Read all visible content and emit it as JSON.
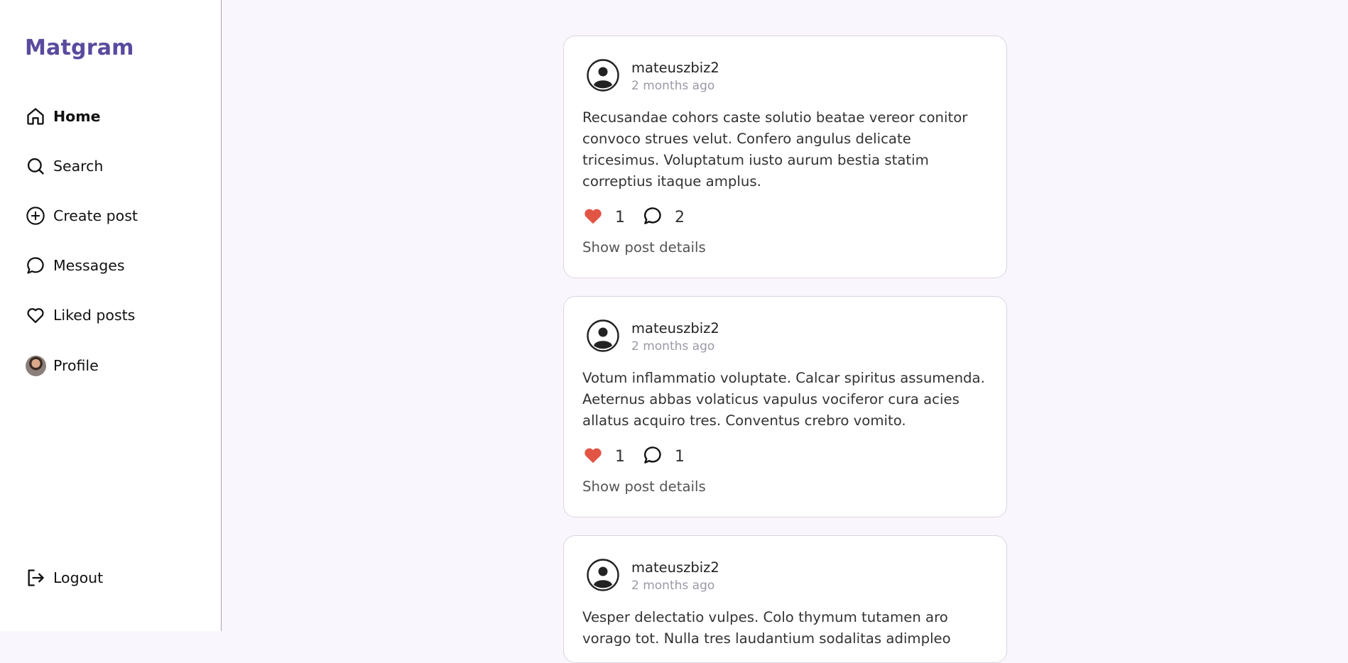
{
  "app": {
    "brand": "Matgram"
  },
  "sidebar": {
    "items": [
      {
        "label": "Home",
        "icon": "home-icon"
      },
      {
        "label": "Search",
        "icon": "search-icon"
      },
      {
        "label": "Create post",
        "icon": "plus-circle-icon"
      },
      {
        "label": "Messages",
        "icon": "chat-bubble-icon"
      },
      {
        "label": "Liked posts",
        "icon": "heart-icon"
      },
      {
        "label": "Profile",
        "icon": "profile-avatar"
      }
    ],
    "logout": {
      "label": "Logout",
      "icon": "logout-icon"
    },
    "active": "Home"
  },
  "colors": {
    "brand": "#5a4a9e",
    "like": "#e25545",
    "page_bg": "#faf6fd"
  },
  "posts": [
    {
      "user": "mateuszbiz2",
      "time": "2 months ago",
      "body": "Recusandae cohors caste solutio beatae vereor conitor convoco strues velut. Confero angulus delicate tricesimus. Voluptatum iusto aurum bestia statim correptius itaque amplus.",
      "likes": "1",
      "comments": "2",
      "details_label": "Show post details"
    },
    {
      "user": "mateuszbiz2",
      "time": "2 months ago",
      "body": "Votum inflammatio voluptate. Calcar spiritus assumenda. Aeternus abbas volaticus vapulus vociferor cura acies allatus acquiro tres. Conventus crebro vomito.",
      "likes": "1",
      "comments": "1",
      "details_label": "Show post details"
    },
    {
      "user": "mateuszbiz2",
      "time": "2 months ago",
      "body": "Vesper delectatio vulpes. Colo thymum tutamen aro vorago tot. Nulla tres laudantium sodalitas adimpleo",
      "likes": "",
      "comments": "",
      "details_label": ""
    }
  ]
}
